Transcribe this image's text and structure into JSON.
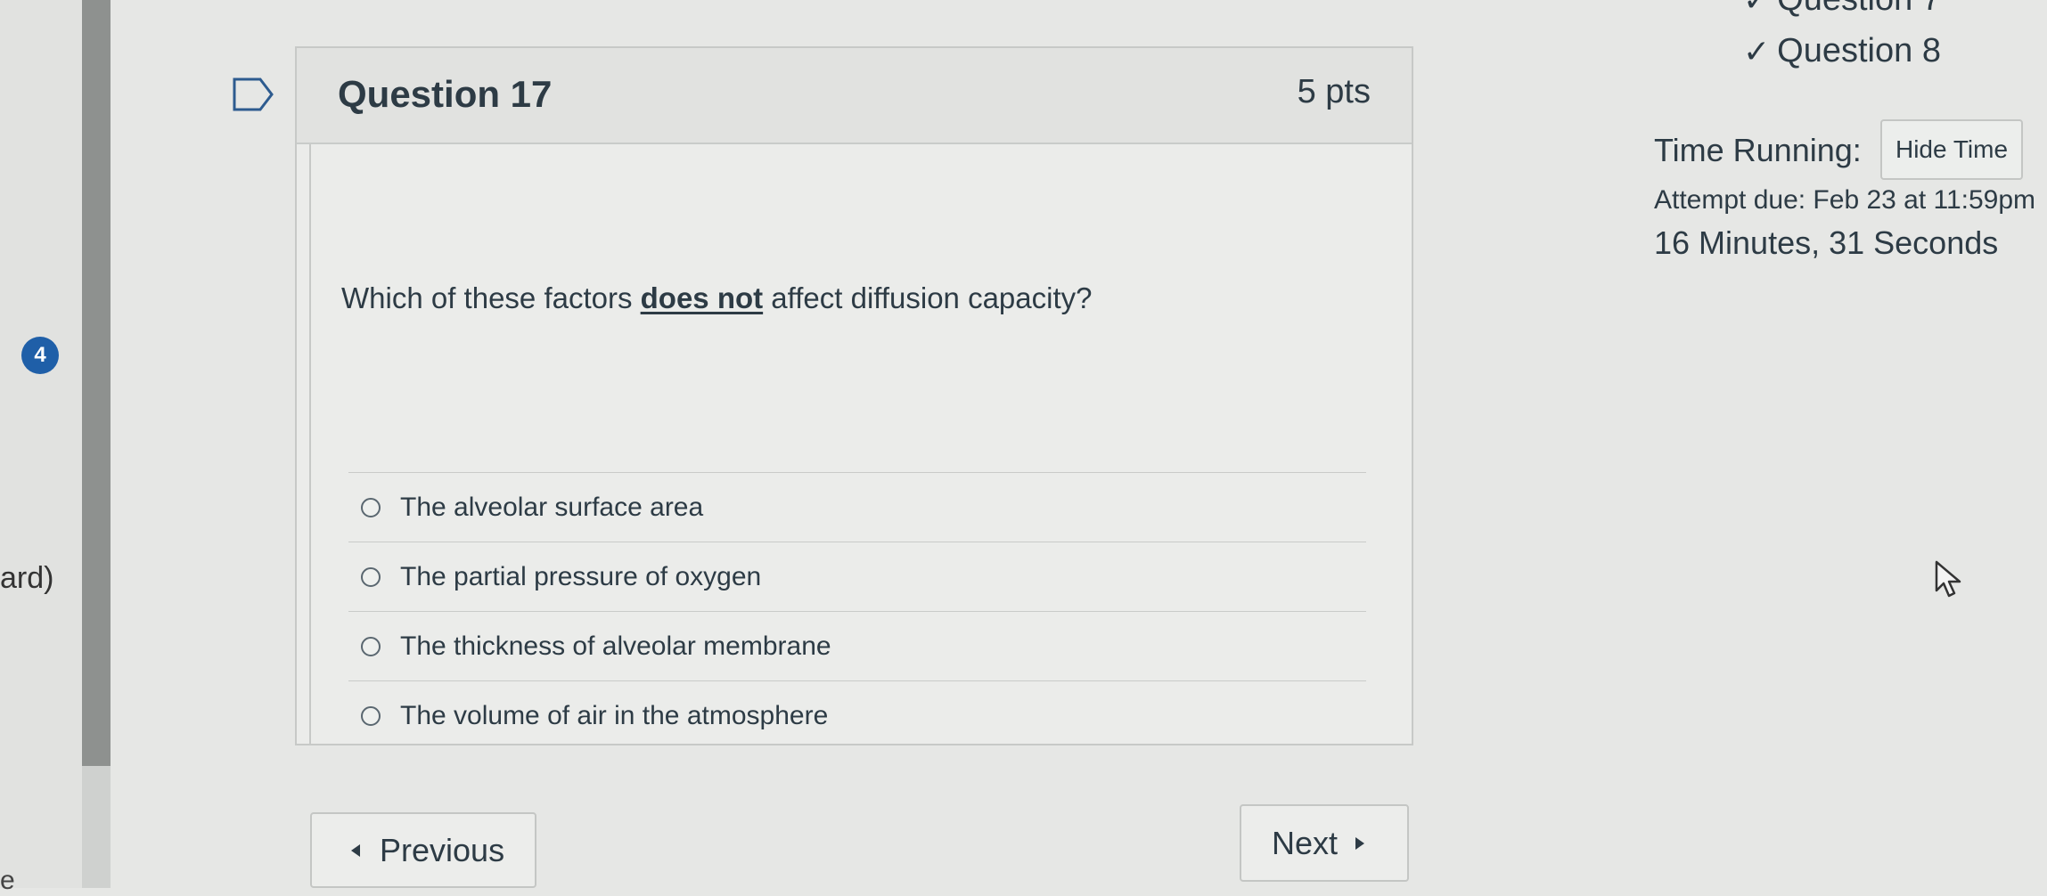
{
  "sidebar": {
    "badge_count": "4",
    "partial_text": "ard)",
    "partial_text_bottom": "e"
  },
  "question": {
    "title": "Question 17",
    "points": "5 pts",
    "text_before": "Which of these factors ",
    "text_emphasis": "does not",
    "text_after": " affect diffusion capacity?",
    "answers": [
      "The alveolar surface area",
      "The partial pressure of oxygen",
      "The thickness of alveolar membrane",
      "The volume of air in the atmosphere"
    ]
  },
  "navigation": {
    "previous_label": "Previous",
    "next_label": "Next"
  },
  "right_panel": {
    "question_links": [
      "Question 7",
      "Question 8"
    ],
    "time_running_label": "Time Running:",
    "hide_time_label": "Hide Time",
    "attempt_due": "Attempt due: Feb 23 at 11:59pm",
    "time_remaining": "16 Minutes, 31 Seconds"
  },
  "icons": [
    "flag-icon",
    "check-icon",
    "radio-icon",
    "caret-left-icon",
    "caret-right-icon",
    "mouse-pointer-icon"
  ],
  "colors": {
    "accent": "#1f5fa8",
    "text": "#2d3b45",
    "background": "#e6e7e5"
  }
}
